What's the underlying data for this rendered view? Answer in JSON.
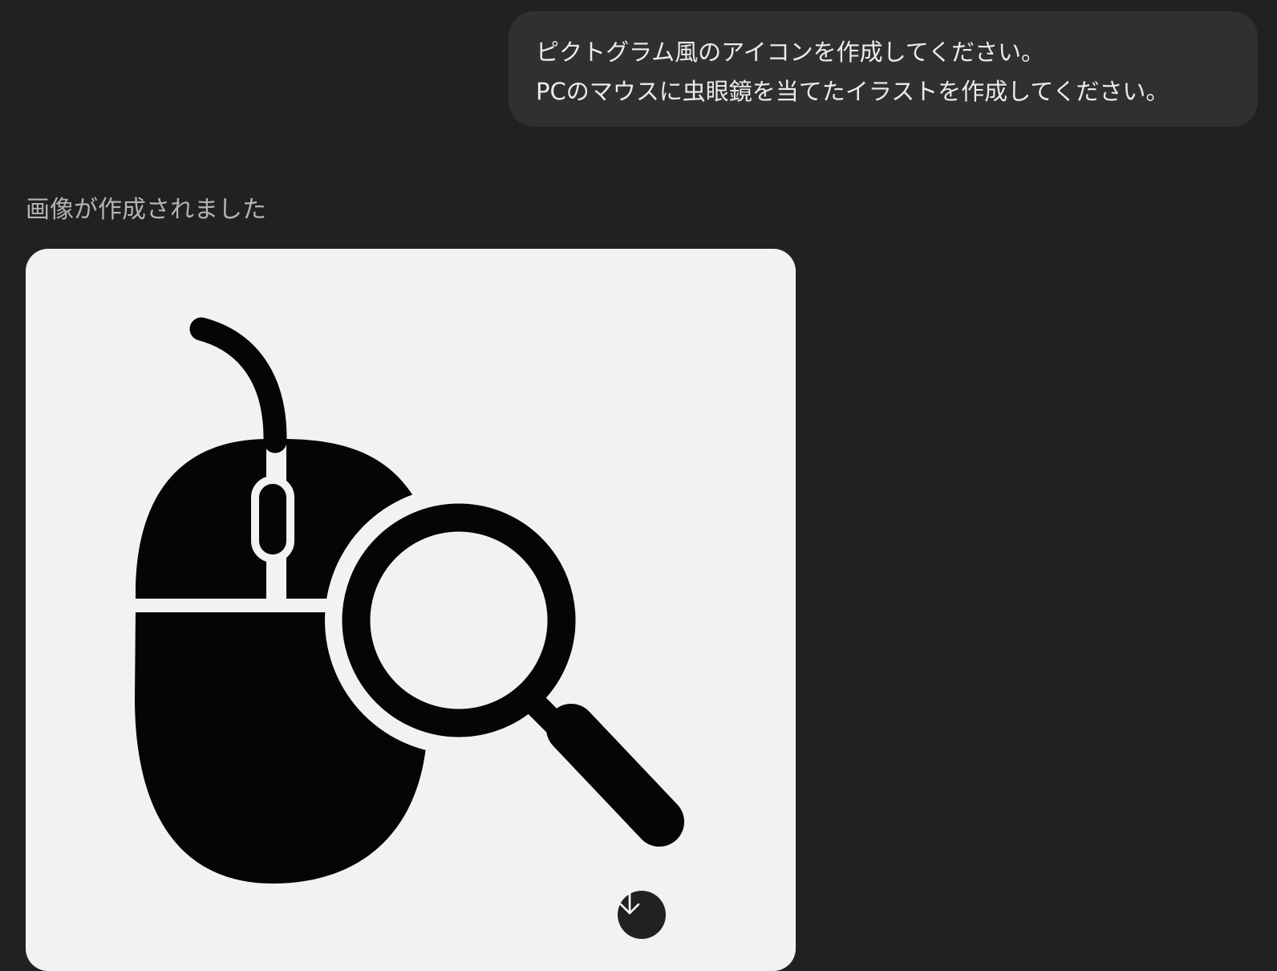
{
  "conversation": {
    "user_message": {
      "lines": [
        "ピクトグラム風のアイコンを作成してください。",
        "PCのマウスに虫眼鏡を当てたイラストを作成してください。"
      ]
    },
    "assistant": {
      "status": "画像が作成されました",
      "image": {
        "icon": "mouse-magnifier-pictogram"
      },
      "download_icon": "arrow-down-icon"
    }
  },
  "colors": {
    "page_background": "#212121",
    "user_bubble": "#303030",
    "image_background": "#f2f2f2",
    "pictogram": "#050505"
  }
}
